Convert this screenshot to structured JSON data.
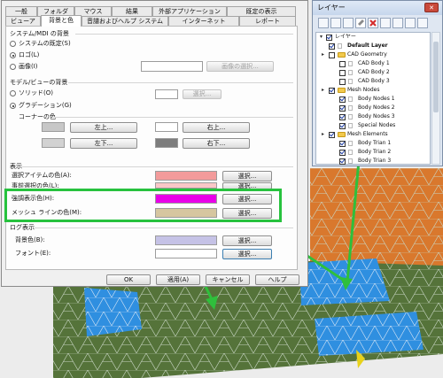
{
  "dialog": {
    "tabs_row1": [
      "一般",
      "フォルダ",
      "マウス",
      "結果",
      "外部アプリケーション",
      "既定の表示"
    ],
    "tabs_row2": [
      "ビューア",
      "背景と色",
      "音譜およびヘルプ システム",
      "インターネット",
      "レポート"
    ],
    "system_bg": {
      "title": "システム/MDI の背景",
      "radio_default": "システムの既定(S)",
      "radio_logo": "ロゴ(L)",
      "radio_image": "画像(I)",
      "image_select_button": "画像の選択..."
    },
    "model_bg": {
      "title": "モデル/ビューの背景",
      "radio_solid": "ソリッド(O)",
      "radio_gradient": "グラデーション(G)",
      "select_button": "選択...",
      "corner_title": "コーナーの色",
      "top_left": "左上...",
      "top_right": "右上...",
      "bottom_left": "左下...",
      "bottom_right": "右下..."
    },
    "display": {
      "title": "表示",
      "rows": [
        {
          "label": "選択アイテムの色(A):",
          "button": "選択...",
          "color": "#f39b9b"
        },
        {
          "label": "事前選択の色(L):",
          "button": "選択...",
          "color": "#f9c7c7"
        },
        {
          "label": "強調表示色(H):",
          "button": "選択...",
          "color": "#e800e8"
        },
        {
          "label": "メッシュ ラインの色(M):",
          "button": "選択...",
          "color": "#d6c6a0"
        }
      ]
    },
    "log_display": {
      "title": "ログ表示",
      "rows": [
        {
          "label": "背景色(B):",
          "button": "選択...",
          "color": "#c5c2e6"
        },
        {
          "label": "フォント(E):",
          "button": "選択...",
          "color": "#ffffff"
        }
      ]
    },
    "footer": {
      "ok": "OK",
      "apply": "適用(A)",
      "cancel": "キャンセル",
      "help": "ヘルプ"
    }
  },
  "layer_window": {
    "title": "レイヤー",
    "close": "✕",
    "root": "レイヤー",
    "items": [
      {
        "label": "Default Layer",
        "checked": true,
        "folder": false,
        "level": 1
      },
      {
        "label": "CAD Geometry",
        "checked": false,
        "folder": true,
        "level": 1
      },
      {
        "label": "CAD Body 1",
        "checked": false,
        "folder": false,
        "level": 2
      },
      {
        "label": "CAD Body 2",
        "checked": false,
        "folder": false,
        "level": 2
      },
      {
        "label": "CAD Body 3",
        "checked": false,
        "folder": false,
        "level": 2
      },
      {
        "label": "Mesh Nodes",
        "checked": true,
        "folder": true,
        "level": 1
      },
      {
        "label": "Body Nodes 1",
        "checked": true,
        "folder": false,
        "level": 2
      },
      {
        "label": "Body Nodes 2",
        "checked": true,
        "folder": false,
        "level": 2
      },
      {
        "label": "Body Nodes 3",
        "checked": true,
        "folder": false,
        "level": 2
      },
      {
        "label": "Special Nodes",
        "checked": true,
        "folder": false,
        "level": 2
      },
      {
        "label": "Mesh Elements",
        "checked": true,
        "folder": true,
        "level": 1
      },
      {
        "label": "Body Trian 1",
        "checked": true,
        "folder": false,
        "level": 2
      },
      {
        "label": "Body Trian 2",
        "checked": true,
        "folder": false,
        "level": 2
      },
      {
        "label": "Body Trian 3",
        "checked": true,
        "folder": false,
        "level": 2
      }
    ]
  },
  "colors": {
    "highlight_box": "#27c23e",
    "arrow": "#2fbf3c",
    "mesh_green": "#55733a",
    "mesh_blue": "#2f8fe0",
    "mesh_orange": "#d9782d"
  }
}
